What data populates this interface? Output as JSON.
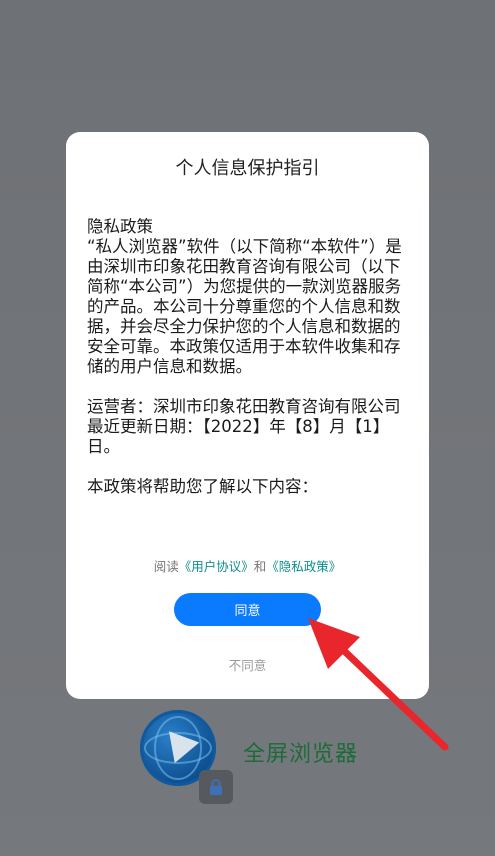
{
  "dialog": {
    "title": "个人信息保护指引",
    "body": {
      "heading": "隐私政策",
      "paragraph1": "“私人浏览器”软件（以下简称“本软件”）是由深圳市印象花田教育咨询有限公司（以下简称“本公司”）为您提供的一款浏览器服务的产品。本公司十分尊重您的个人信息和数据，并会尽全力保护您的个人信息和数据的安全可靠。本政策仅适用于本软件收集和存储的用户信息和数据。",
      "operator": "运营者：深圳市印象花田教育咨询有限公司",
      "updated": "最近更新日期：【2022】年【8】月【1】日。",
      "intro": "本政策将帮助您了解以下内容："
    },
    "agreement": {
      "prefix": "阅读",
      "user_agreement": "《用户协议》",
      "and": "和",
      "privacy_policy": "《隐私政策》"
    },
    "agree_label": "同意",
    "disagree_label": "不同意"
  },
  "background_app": {
    "name": "全屏浏览器"
  },
  "colors": {
    "accent": "#0a7aff",
    "link": "#0e8e8e",
    "annotation": "#e8262c",
    "app_name": "#1d6b3a"
  }
}
